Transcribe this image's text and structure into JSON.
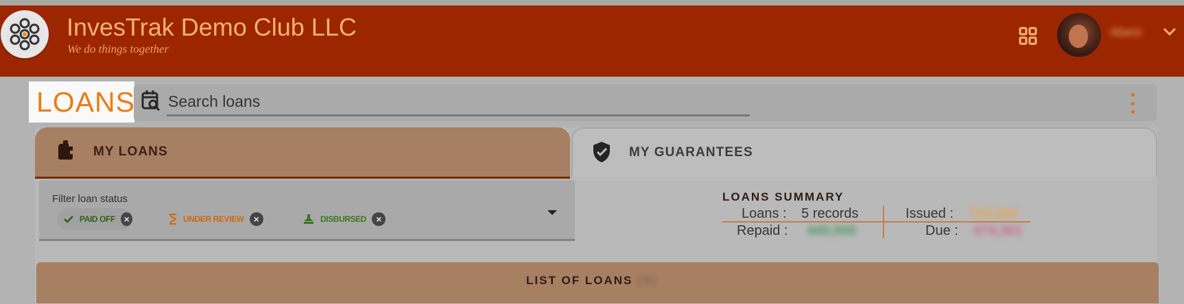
{
  "app": {
    "title": "InvesTrak Demo Club LLC",
    "tagline": "We do things together",
    "username": "Abeni"
  },
  "page": {
    "section_label": "LOANS",
    "search_placeholder": "Search loans"
  },
  "tabs": [
    {
      "label": "MY LOANS",
      "active": true,
      "icon": "wallet-icon"
    },
    {
      "label": "MY GUARANTEES",
      "active": false,
      "icon": "shield-check-icon"
    }
  ],
  "filter": {
    "label": "Filter loan status",
    "chips": [
      {
        "label": "PAID OFF",
        "color": "#2f6117",
        "icon": "check-icon"
      },
      {
        "label": "UNDER REVIEW",
        "color": "#cc6a10",
        "icon": "hourglass-icon"
      },
      {
        "label": "DISBURSED",
        "color": "#3b751f",
        "icon": "stamp-icon"
      }
    ]
  },
  "summary": {
    "title": "LOANS SUMMARY",
    "loans_label": "Loans :",
    "loans_value": "5 records",
    "issued_label": "Issued :",
    "issued_value": "753,000",
    "repaid_label": "Repaid :",
    "repaid_value": "445,000",
    "due_label": "Due :",
    "due_value": "474,361"
  },
  "list": {
    "title": "LIST OF LOANS",
    "count": "(5)"
  },
  "colors": {
    "header": "#9c2600",
    "accent": "#e97c16",
    "tab_active": "#a77f62"
  }
}
